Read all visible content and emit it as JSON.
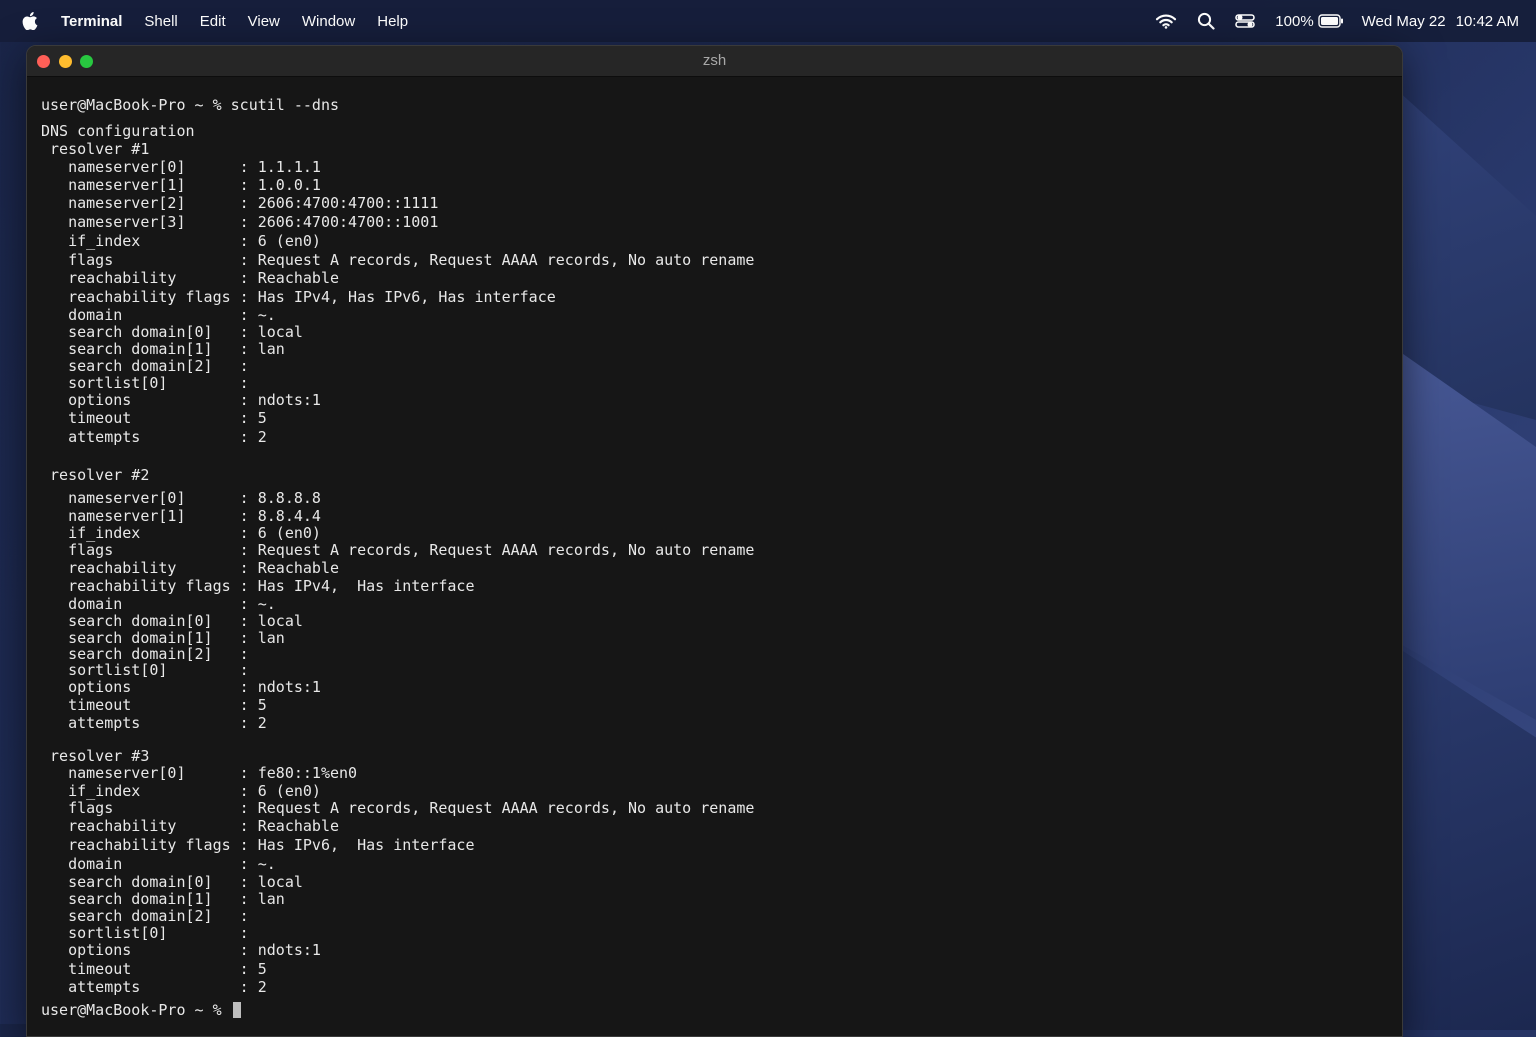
{
  "menubar": {
    "apple_icon": "apple-logo-icon",
    "app_name": "Terminal",
    "menus": [
      "Shell",
      "Edit",
      "View",
      "Window",
      "Help"
    ],
    "status_icons": [
      "wifi-icon",
      "search-icon",
      "control-center-icon",
      "battery-icon"
    ],
    "battery_percent": "100%",
    "date": "Wed May 22",
    "time": "10:42 AM"
  },
  "window": {
    "title": "zsh",
    "controls": [
      "close-button",
      "minimize-button",
      "zoom-button"
    ]
  },
  "terminal": {
    "lines": [
      "user@MacBook-Pro ~ % scutil --dns",
      "DNS configuration",
      " resolver #1",
      "   nameserver[0]      : 1.1.1.1",
      "   nameserver[1]      : 1.0.0.1",
      "   nameserver[2]      : 2606:4700:4700::1111",
      "   nameserver[3]      : 2606:4700:4700::1001",
      "   if_index           : 6 (en0)",
      "   flags              : Request A records, Request AAAA records, No auto rename",
      "   reachability       : Reachable",
      "   reachability flags : Has IPv4, Has IPv6, Has interface",
      "   domain             : ~.",
      "   search domain[0]   : local",
      "   search domain[1]   : lan",
      "   search domain[2]   :",
      "   sortlist[0]        :",
      "   options            : ndots:1",
      "   timeout            : 5",
      "   attempts           : 2",
      " resolver #2",
      "   nameserver[0]      : 8.8.8.8",
      "   nameserver[1]      : 8.8.4.4",
      "   if_index           : 6 (en0)",
      "   flags              : Request A records, Request AAAA records, No auto rename",
      "   reachability       : Reachable",
      "   reachability flags : Has IPv4,  Has interface",
      "   domain             : ~.",
      "   search domain[0]   : local",
      "   search domain[1]   : lan",
      "   search domain[2]   :",
      "   sortlist[0]        :",
      "   options            : ndots:1",
      "   timeout            : 5",
      "   attempts           : 2",
      " resolver #3",
      "   nameserver[0]      : fe80::1%en0",
      "   if_index           : 6 (en0)",
      "   flags              : Request A records, Request AAAA records, No auto rename",
      "   reachability       : Reachable",
      "   reachability flags : Has IPv6,  Has interface",
      "   domain             : ~.",
      "   search domain[0]   : local",
      "   search domain[1]   : lan",
      "   search domain[2]   :",
      "   sortlist[0]        :",
      "   options            : ndots:1",
      "   timeout            : 5",
      "   attempts           : 2"
    ],
    "prompt": "user@MacBook-Pro ~ % "
  }
}
